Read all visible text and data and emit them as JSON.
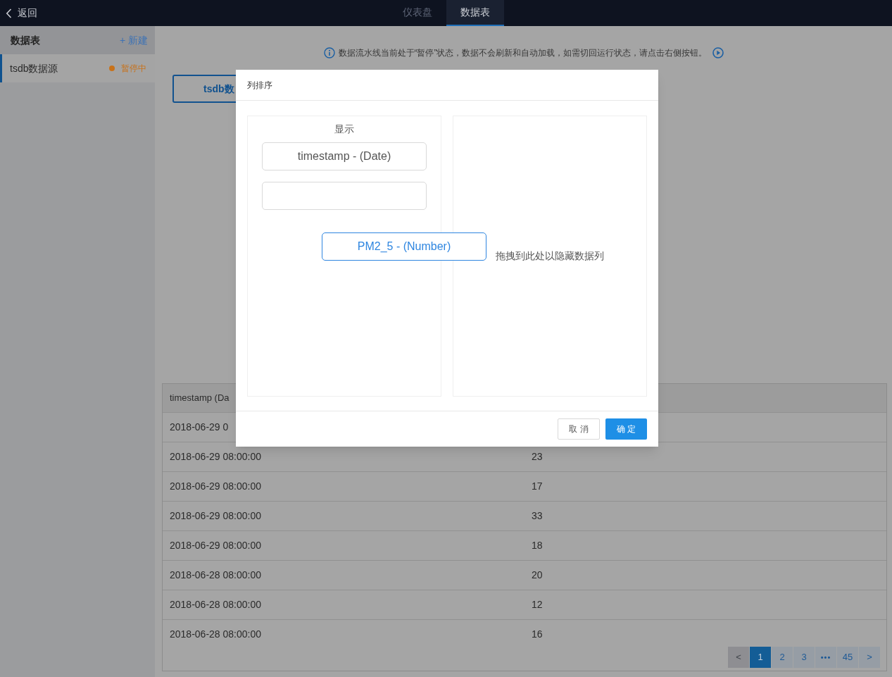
{
  "top_bar": {
    "back_button": {
      "label": "返回"
    },
    "tabs": [
      {
        "label": "仪表盘",
        "selected": false
      },
      {
        "label": "数据表",
        "selected": true
      }
    ]
  },
  "sidebar": {
    "title": "数据表",
    "new_button": {
      "label": "+ 新建"
    },
    "items": [
      {
        "label": "tsdb数据源",
        "selected": true,
        "status": "暂停中",
        "color": "#c8721a"
      }
    ]
  },
  "notice": {
    "text": "数据流水线当前处于“暂停”状态，数据不会刷新和自动加载，如需切回运行状态，请点击右侧按钮。"
  },
  "source_button": {
    "label": "tsdb数"
  },
  "table": {
    "columns": [
      "timestamp (Da"
    ],
    "rows": [
      [
        "2018-06-29 0"
      ],
      [
        "2018-06-29 08:00:00",
        "23"
      ],
      [
        "2018-06-29 08:00:00",
        "17"
      ],
      [
        "2018-06-29 08:00:00",
        "33"
      ],
      [
        "2018-06-29 08:00:00",
        "18"
      ],
      [
        "2018-06-28 08:00:00",
        "20"
      ],
      [
        "2018-06-28 08:00:00",
        "12"
      ],
      [
        "2018-06-28 08:00:00",
        "16"
      ]
    ]
  },
  "pagination": [
    {
      "kind": "prev",
      "label": "<",
      "selected": false,
      "disabled": true
    },
    {
      "kind": "page",
      "label": "1",
      "selected": true,
      "disabled": false
    },
    {
      "kind": "page",
      "label": "2",
      "selected": false,
      "disabled": false
    },
    {
      "kind": "page",
      "label": "3",
      "selected": false,
      "disabled": false
    },
    {
      "kind": "more",
      "label": "•••",
      "selected": false,
      "disabled": false
    },
    {
      "kind": "page",
      "label": "45",
      "selected": false,
      "disabled": false
    },
    {
      "kind": "next",
      "label": ">",
      "selected": false,
      "disabled": false
    }
  ],
  "dialog": {
    "title": "列排序",
    "shown": {
      "title": "显示",
      "items": [
        {
          "kind": "column",
          "label": "timestamp - (Date)"
        },
        {
          "kind": "slot"
        }
      ]
    },
    "hidden": {
      "hint": "拖拽到此处以隐藏数据列"
    },
    "dragging": {
      "label": "PM2_5 - (Number)"
    },
    "buttons": [
      {
        "kind": "secondary",
        "label": "取 消"
      },
      {
        "kind": "primary",
        "label": "确 定"
      }
    ]
  }
}
